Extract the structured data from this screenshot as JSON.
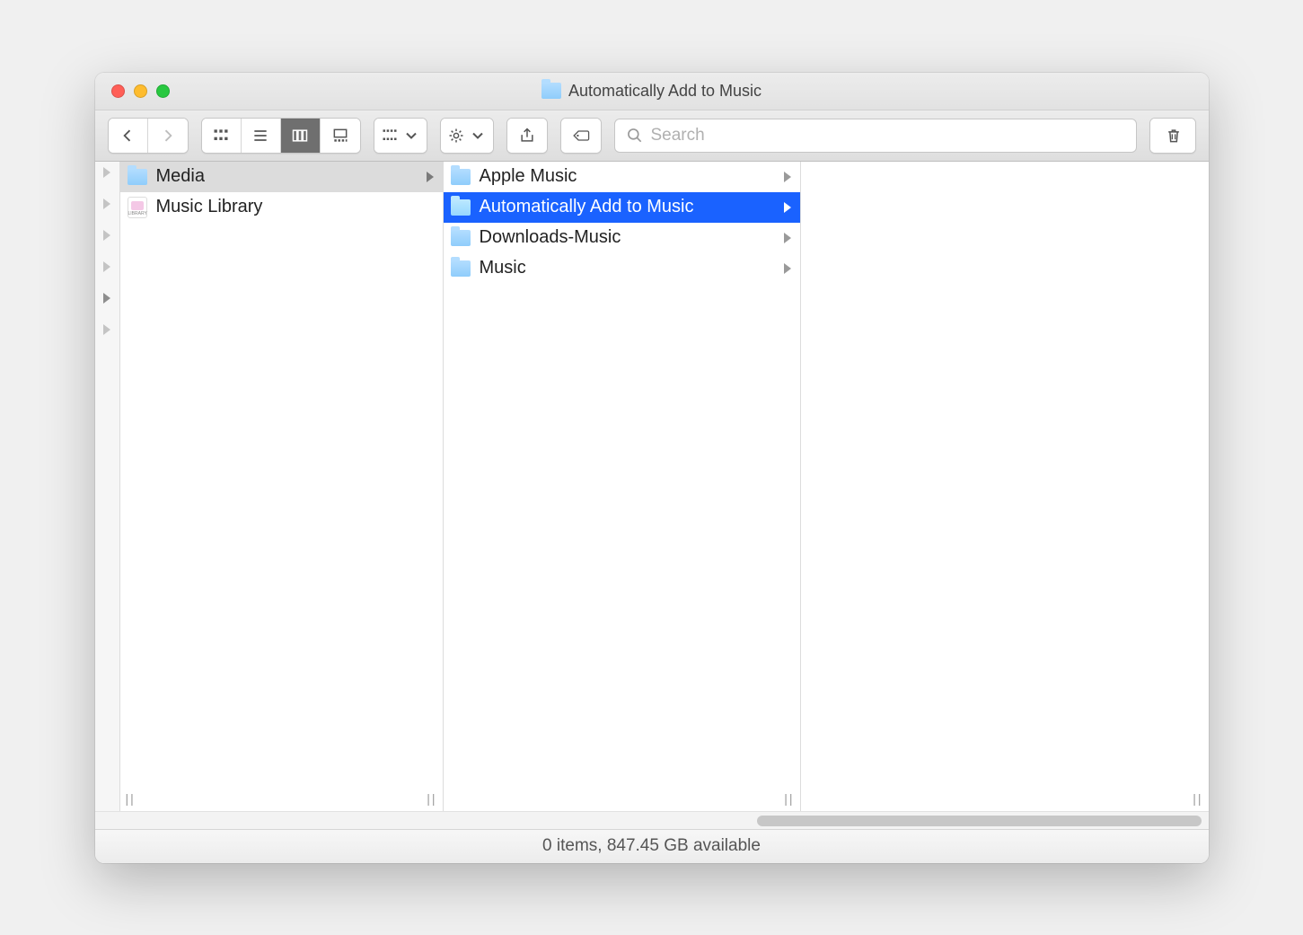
{
  "window": {
    "title": "Automatically Add to Music"
  },
  "toolbar": {
    "search_placeholder": "Search"
  },
  "columns": [
    {
      "items": [
        {
          "label": "Media",
          "kind": "folder",
          "has_children": true,
          "selected": "gray"
        },
        {
          "label": "Music Library",
          "kind": "file",
          "has_children": false,
          "selected": "none"
        }
      ]
    },
    {
      "items": [
        {
          "label": "Apple Music",
          "kind": "folder",
          "has_children": true,
          "selected": "none"
        },
        {
          "label": "Automatically Add to Music",
          "kind": "folder",
          "has_children": true,
          "selected": "blue"
        },
        {
          "label": "Downloads-Music",
          "kind": "folder",
          "has_children": true,
          "selected": "none"
        },
        {
          "label": "Music",
          "kind": "folder",
          "has_children": true,
          "selected": "none"
        }
      ]
    },
    {
      "items": []
    }
  ],
  "status": {
    "text": "0 items, 847.45 GB available"
  }
}
